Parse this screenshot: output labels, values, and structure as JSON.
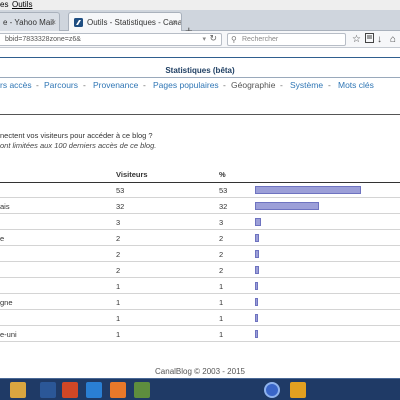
{
  "menu": {
    "items": [
      "es",
      "Outils"
    ]
  },
  "tabs": [
    {
      "label": "e - Yahoo Mail",
      "close": "×",
      "active": false
    },
    {
      "label": "Outils - Statistiques - Canal...",
      "close": "×",
      "active": true
    }
  ],
  "new_tab": "+",
  "address": {
    "url": "bbid=7833328zone=z6&",
    "dropdown": "▾",
    "reload": "↻"
  },
  "search": {
    "placeholder": "Rechercher"
  },
  "toolbar_icons": [
    "star-icon",
    "reader-icon",
    "download-icon",
    "home-icon",
    "menu-icon"
  ],
  "page": {
    "stats_title": "Statistiques (bêta)",
    "nav": [
      {
        "label": "rs accès",
        "current": false
      },
      {
        "label": "Parcours",
        "current": false
      },
      {
        "label": "Provenance",
        "current": false
      },
      {
        "label": "Pages populaires",
        "current": false
      },
      {
        "label": "Géographie",
        "current": true
      },
      {
        "label": "Système",
        "current": false
      },
      {
        "label": "Mots clés",
        "current": false
      }
    ],
    "nav_separator": "-",
    "question": "nectent vos visiteurs pour accéder à ce blog ?",
    "note": "ont limitées aux 100 derniers accès de ce blog.",
    "table": {
      "headers": {
        "visitors": "Visiteurs",
        "percent": "%"
      },
      "rows": [
        {
          "name": "",
          "visitors": "53",
          "percent": "53",
          "share": 53
        },
        {
          "name": "ais",
          "visitors": "32",
          "percent": "32",
          "share": 32
        },
        {
          "name": "",
          "visitors": "3",
          "percent": "3",
          "share": 3
        },
        {
          "name": "e",
          "visitors": "2",
          "percent": "2",
          "share": 2
        },
        {
          "name": "",
          "visitors": "2",
          "percent": "2",
          "share": 2
        },
        {
          "name": "",
          "visitors": "2",
          "percent": "2",
          "share": 2
        },
        {
          "name": "",
          "visitors": "1",
          "percent": "1",
          "share": 1
        },
        {
          "name": "gne",
          "visitors": "1",
          "percent": "1",
          "share": 1
        },
        {
          "name": "",
          "visitors": "1",
          "percent": "1",
          "share": 1
        },
        {
          "name": "e-uni",
          "visitors": "1",
          "percent": "1",
          "share": 1
        }
      ]
    },
    "footer": "CanalBlog © 2003 - 2015"
  },
  "taskbar": {
    "apps": [
      {
        "icon": "file-explorer-icon",
        "color": "#d9a640"
      },
      {
        "icon": "word-icon",
        "color": "#2b5797"
      },
      {
        "icon": "powerpoint-icon",
        "color": "#d24726"
      },
      {
        "icon": "internet-explorer-icon",
        "color": "#2a7fd4"
      },
      {
        "icon": "firefox-icon",
        "color": "#e8782a"
      },
      {
        "icon": "photos-icon",
        "color": "#5e8e3e"
      },
      {
        "icon": "media-player-icon",
        "color": "#3a66c9"
      },
      {
        "icon": "windows-media-icon",
        "color": "#e3a020"
      }
    ]
  },
  "colors": {
    "link": "#2f76b5",
    "bar_fill": "#9c9fd8",
    "bar_border": "#6e73c0",
    "taskbar": "#1f3a66"
  }
}
